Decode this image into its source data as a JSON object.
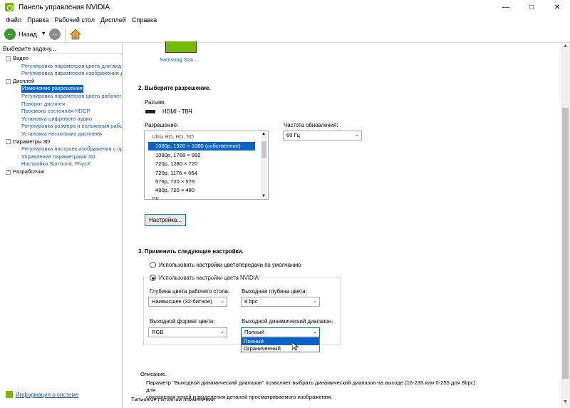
{
  "window": {
    "title": "Панель управления NVIDIA"
  },
  "menu": [
    "Файл",
    "Правка",
    "Рабочий стол",
    "Дисплей",
    "Справка"
  ],
  "toolbar": {
    "back_label": "Назад"
  },
  "sidebar": {
    "header": "Выберите задачу...",
    "categories": [
      {
        "label": "Видео",
        "items": [
          "Регулировка параметров цвета для вид",
          "Регулировка параметров изображения д"
        ]
      },
      {
        "label": "Дисплей",
        "items": [
          "Изменение разрешения",
          "Регулировка параметров цвета рабочег",
          "Поворот дисплея",
          "Просмотр состояния HDCP",
          "Установка цифрового аудио",
          "Регулировка размера и положения рабо",
          "Установка нескольких дисплеев"
        ]
      },
      {
        "label": "Параметры 3D",
        "items": [
          "Регулировка настроек изображения с пр",
          "Управление параметрами 3D",
          "Настройка Surround, PhysX"
        ]
      },
      {
        "label": "Разработчик",
        "items": []
      }
    ],
    "selected_item": "Изменение разрешения",
    "system_info_link": "Информация о системе"
  },
  "monitor": {
    "name": "Samsung S24..."
  },
  "section2": {
    "title": "2. Выберите разрешение.",
    "connector_label": "Разъем:",
    "connector_value": "HDMI - ТВЧ",
    "resolution_label": "Разрешение:",
    "refresh_label": "Частота обновления:",
    "refresh_value": "60 Гц",
    "resolution_group": "Ultra HD, HD, SD",
    "resolutions": [
      "1080p, 1920 × 1080 (собственное)",
      "1080p, 1768 × 992",
      "720p, 1280 × 720",
      "720p, 1176 × 664",
      "576p, 720 × 576",
      "480p, 720 × 480"
    ],
    "resolution_group_2": "ПК",
    "customize_button": "Настройка..."
  },
  "section3": {
    "title": "3. Применить следующие настройки.",
    "radio_default": "Использовать настройки цветопередачи по умолчанию",
    "radio_nvidia": "Использовать настройки цвета NVIDIA",
    "desktop_depth_label": "Глубина цвета рабочего стола:",
    "desktop_depth_value": "Наивысшее (32-битное)",
    "output_depth_label": "Выходная глубина цвета:",
    "output_depth_value": "8 bpc",
    "output_format_label": "Выходной формат цвета:",
    "output_format_value": "RGB",
    "dynamic_range_label": "Выходной динамический диапазон:",
    "dynamic_range_value": "Полный",
    "dynamic_range_options": [
      "Полный",
      "Ограниченный"
    ]
  },
  "description": {
    "label": "Описание.",
    "text_line1": "Параметр \"Выходной динамический диапазон\" позволяет выбрать динамический диапазон на выходе (16-235 или 0-255 для 8bpc) для",
    "text_line2": "сохранения теней и выделения деталей просматриваемого изображения."
  },
  "footer_partial": "Типичные ситуации применения"
}
